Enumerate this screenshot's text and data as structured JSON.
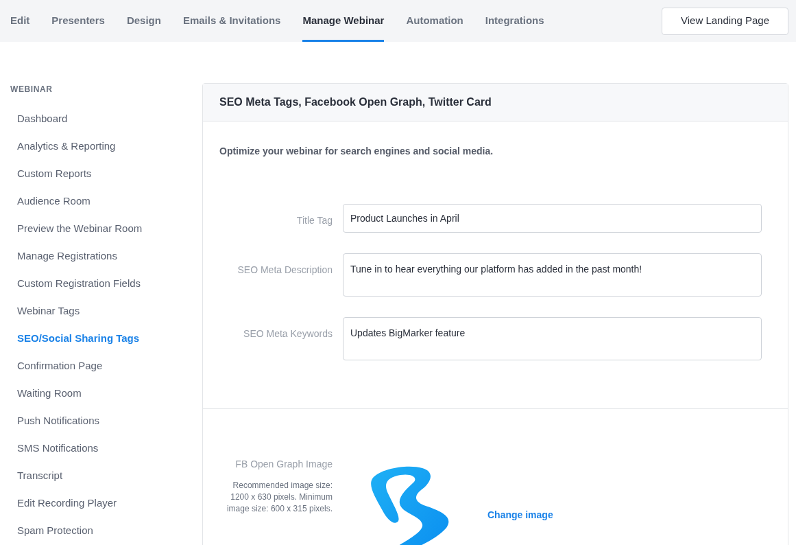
{
  "tabs": [
    {
      "label": "Edit",
      "selected": false
    },
    {
      "label": "Presenters",
      "selected": false
    },
    {
      "label": "Design",
      "selected": false
    },
    {
      "label": "Emails & Invitations",
      "selected": false
    },
    {
      "label": "Manage Webinar",
      "selected": true
    },
    {
      "label": "Automation",
      "selected": false
    },
    {
      "label": "Integrations",
      "selected": false
    }
  ],
  "view_button": "View Landing Page",
  "sidebar": {
    "heading": "WEBINAR",
    "items": [
      {
        "label": "Dashboard",
        "selected": false
      },
      {
        "label": "Analytics & Reporting",
        "selected": false
      },
      {
        "label": "Custom Reports",
        "selected": false
      },
      {
        "label": "Audience Room",
        "selected": false
      },
      {
        "label": "Preview the Webinar Room",
        "selected": false
      },
      {
        "label": "Manage Registrations",
        "selected": false
      },
      {
        "label": "Custom Registration Fields",
        "selected": false
      },
      {
        "label": "Webinar Tags",
        "selected": false
      },
      {
        "label": "SEO/Social Sharing Tags",
        "selected": true
      },
      {
        "label": "Confirmation Page",
        "selected": false
      },
      {
        "label": "Waiting Room",
        "selected": false
      },
      {
        "label": "Push Notifications",
        "selected": false
      },
      {
        "label": "SMS Notifications",
        "selected": false
      },
      {
        "label": "Transcript",
        "selected": false
      },
      {
        "label": "Edit Recording Player",
        "selected": false
      },
      {
        "label": "Spam Protection",
        "selected": false
      }
    ]
  },
  "panel": {
    "title": "SEO Meta Tags, Facebook Open Graph, Twitter Card",
    "intro": "Optimize your webinar for search engines and social media.",
    "fields": [
      {
        "label": "Title Tag",
        "value": "Product Launches in April",
        "kind": "input"
      },
      {
        "label": "SEO Meta Description",
        "value": "Tune in to hear everything our platform has added in the past month!",
        "kind": "textarea"
      },
      {
        "label": "SEO Meta Keywords",
        "value": "Updates BigMarker feature",
        "kind": "textarea"
      }
    ],
    "og_image": {
      "label": "FB Open Graph Image",
      "hint": "Recommended image size: 1200 x 630 pixels. Minimum image size: 600 x 315 pixels.",
      "link": "Change image"
    }
  }
}
